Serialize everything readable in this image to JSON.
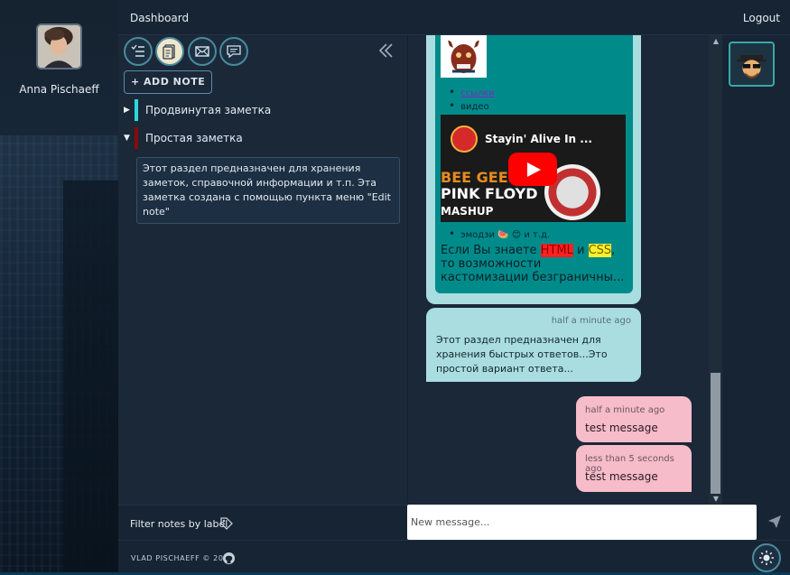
{
  "profile": {
    "name": "Anna Pischaeff"
  },
  "topbar": {
    "dashboard": "Dashboard",
    "logout": "Logout"
  },
  "notes_toolbar": {
    "icons": [
      "list-icon",
      "note-icon",
      "mail-icon",
      "chat-icon"
    ],
    "active": "note-icon",
    "add_note": "+ ADD NOTE"
  },
  "notes_tree": [
    {
      "label": "Продвинутая заметка",
      "expanded": false,
      "color": "#2ed6e0"
    },
    {
      "label": "Простая заметка",
      "expanded": true,
      "color": "#8b0a0a"
    }
  ],
  "note_content": "Этот раздел предназначен для хранения заметок, справочной информации и т.п. Эта заметка создана с помощью пункта меню \"Edit note\"",
  "filter": {
    "label": "Filter notes by label"
  },
  "chat": {
    "card": {
      "list": [
        "ссылки",
        "видео"
      ],
      "video_title": "Stayin' Alive In ...",
      "video_text1": "BEE GEES",
      "video_text2": "PINK FLOYD",
      "video_text3": "MASHUP",
      "emoji_item": "эмодзи 🍉 😊 и т.д.",
      "text_before": "Если Вы знаете ",
      "html": "HTML",
      "and": " и ",
      "css": "CSS",
      "text_after": ", то возможности кастомизации безграничны..."
    },
    "incoming": {
      "time": "half a minute ago",
      "text": "Этот раздел предназначен для хранения быстрых ответов...Это простой вариант ответа..."
    },
    "outgoing": [
      {
        "time": "half a minute ago",
        "text": "test message"
      },
      {
        "time": "less than 5 seconds ago",
        "text": "test message"
      }
    ]
  },
  "composer": {
    "placeholder": "New message..."
  },
  "footer": {
    "copyright": "VLAD PISCHAEFF © 2023"
  },
  "colors": {
    "accent": "#4a8a9e",
    "chat_in": "#a9dde0",
    "chat_out": "#f6bcca",
    "card": "#008b8b"
  }
}
